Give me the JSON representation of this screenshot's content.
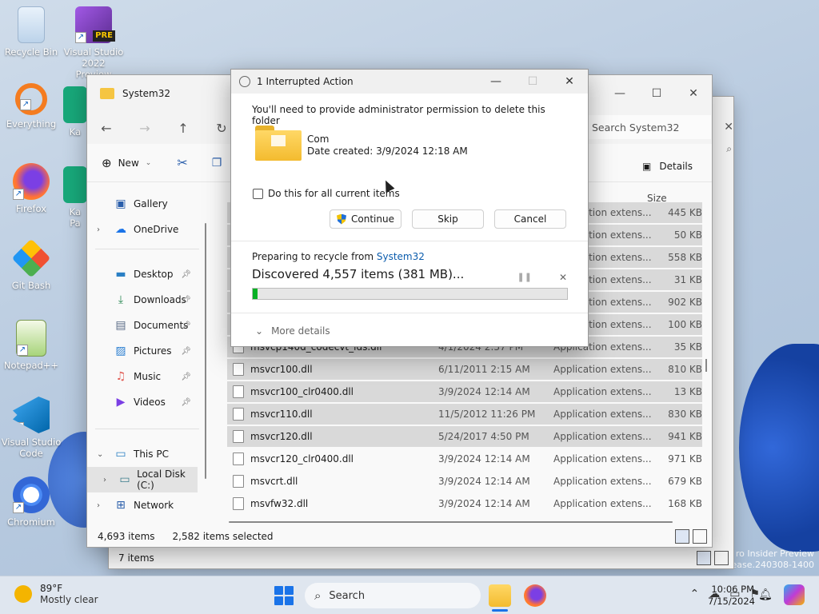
{
  "desktop": {
    "icons": [
      {
        "label": "Recycle Bin",
        "name": "recycle-bin-icon"
      },
      {
        "label": "Visual Studio 2022 Preview",
        "name": "visual-studio-preview-icon",
        "badge": "PRE"
      },
      {
        "label": "Everything",
        "name": "everything-icon"
      },
      {
        "label": "Ka",
        "name": "kaspersky-icon"
      },
      {
        "label": "Firefox",
        "name": "firefox-icon"
      },
      {
        "label": "Ka Pa",
        "name": "kaspersky-password-icon"
      },
      {
        "label": "Git Bash",
        "name": "git-bash-icon"
      },
      {
        "label": "Notepad++",
        "name": "notepadpp-icon"
      },
      {
        "label": "Visual Studio Code",
        "name": "vscode-icon"
      },
      {
        "label": "Chromium",
        "name": "chromium-icon"
      }
    ],
    "watermark_line1": "ro Insider Preview",
    "watermark_line2": "elease.240308-1400"
  },
  "explorer": {
    "title": "System32",
    "search_placeholder": "Search System32",
    "new_label": "New",
    "details_label": "Details",
    "column_size": "Size",
    "sidebar": [
      {
        "label": "Gallery",
        "icon": "gallery-icon",
        "pinned": false,
        "expand": false
      },
      {
        "label": "OneDrive",
        "icon": "onedrive-icon",
        "pinned": false,
        "expand": true
      },
      {
        "label": "Desktop",
        "icon": "desktop-icon",
        "pinned": true,
        "expand": false
      },
      {
        "label": "Downloads",
        "icon": "downloads-icon",
        "pinned": true,
        "expand": false
      },
      {
        "label": "Documents",
        "icon": "documents-icon",
        "pinned": true,
        "expand": false
      },
      {
        "label": "Pictures",
        "icon": "pictures-icon",
        "pinned": true,
        "expand": false
      },
      {
        "label": "Music",
        "icon": "music-icon",
        "pinned": true,
        "expand": false
      },
      {
        "label": "Videos",
        "icon": "videos-icon",
        "pinned": true,
        "expand": false
      },
      {
        "label": "This PC",
        "icon": "this-pc-icon",
        "pinned": false,
        "expand": true
      },
      {
        "label": "Local Disk (C:)",
        "icon": "local-disk-icon",
        "pinned": false,
        "expand": true
      },
      {
        "label": "Network",
        "icon": "network-icon",
        "pinned": false,
        "expand": true
      }
    ],
    "files": [
      {
        "name": "",
        "date": "",
        "type": "Application extens...",
        "size": "445 KB",
        "selected": true
      },
      {
        "name": "",
        "date": "",
        "type": "Application extens...",
        "size": "50 KB",
        "selected": true
      },
      {
        "name": "",
        "date": "",
        "type": "Application extens...",
        "size": "558 KB",
        "selected": true
      },
      {
        "name": "",
        "date": "",
        "type": "Application extens...",
        "size": "31 KB",
        "selected": true
      },
      {
        "name": "",
        "date": "",
        "type": "Application extens...",
        "size": "902 KB",
        "selected": true
      },
      {
        "name": "",
        "date": "",
        "type": "Application extens...",
        "size": "100 KB",
        "selected": true
      },
      {
        "name": "msvcp140d_codecvt_ids.dll",
        "date": "4/1/2024 2:37 PM",
        "type": "Application extens...",
        "size": "35 KB",
        "selected": true
      },
      {
        "name": "msvcr100.dll",
        "date": "6/11/2011 2:15 AM",
        "type": "Application extens...",
        "size": "810 KB",
        "selected": true
      },
      {
        "name": "msvcr100_clr0400.dll",
        "date": "3/9/2024 12:14 AM",
        "type": "Application extens...",
        "size": "13 KB",
        "selected": true
      },
      {
        "name": "msvcr110.dll",
        "date": "11/5/2012 11:26 PM",
        "type": "Application extens...",
        "size": "830 KB",
        "selected": true
      },
      {
        "name": "msvcr120.dll",
        "date": "5/24/2017 4:50 PM",
        "type": "Application extens...",
        "size": "941 KB",
        "selected": true
      },
      {
        "name": "msvcr120_clr0400.dll",
        "date": "3/9/2024 12:14 AM",
        "type": "Application extens...",
        "size": "971 KB",
        "selected": false
      },
      {
        "name": "msvcrt.dll",
        "date": "3/9/2024 12:14 AM",
        "type": "Application extens...",
        "size": "679 KB",
        "selected": false
      },
      {
        "name": "msvfw32.dll",
        "date": "3/9/2024 12:14 AM",
        "type": "Application extens...",
        "size": "168 KB",
        "selected": false
      }
    ],
    "status_items": "4,693 items",
    "status_selected": "2,582 items selected",
    "back_window_status": "7 items"
  },
  "dialog": {
    "title": "1 Interrupted Action",
    "message": "You'll need to provide administrator permission to delete this folder",
    "folder_name": "Com",
    "folder_date": "Date created: 3/9/2024 12:18 AM",
    "checkbox_label": "Do this for all current items",
    "continue_label": "Continue",
    "skip_label": "Skip",
    "cancel_label": "Cancel",
    "preparing_prefix": "Preparing to recycle from",
    "preparing_link": "System32",
    "discovered": "Discovered 4,557 items (381 MB)...",
    "progress_fraction": 0.015,
    "more_details": "More details"
  },
  "taskbar": {
    "temperature": "89°F",
    "weather": "Mostly clear",
    "search_label": "Search",
    "time": "10:06 PM",
    "date": "7/15/2024"
  }
}
